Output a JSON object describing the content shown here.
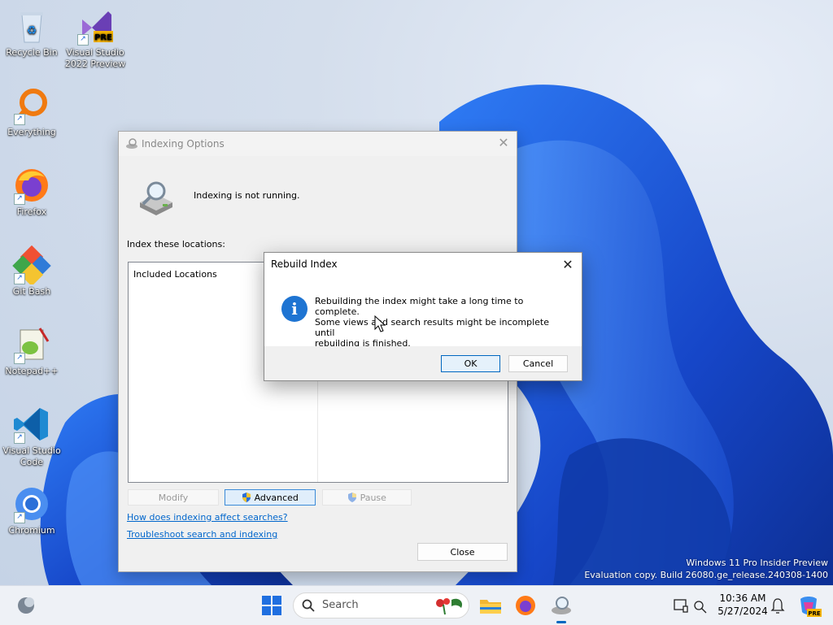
{
  "desktop": {
    "icons": [
      {
        "label": "Recycle Bin"
      },
      {
        "label": "Visual Studio 2022 Preview",
        "badge": "PRE"
      },
      {
        "label": "Everything"
      },
      {
        "label": "Firefox"
      },
      {
        "label": "Git Bash"
      },
      {
        "label": "Notepad++"
      },
      {
        "label": "Visual Studio Code"
      },
      {
        "label": "Chromium"
      }
    ],
    "watermark": {
      "line1": "Windows 11 Pro Insider Preview",
      "line2": "Evaluation copy. Build 26080.ge_release.240308-1400"
    }
  },
  "indexing_window": {
    "title": "Indexing Options",
    "status": "Indexing is not running.",
    "locations_label": "Index these locations:",
    "column_header": "Included Locations",
    "buttons": {
      "modify": "Modify",
      "advanced": "Advanced",
      "pause": "Pause",
      "close": "Close"
    },
    "links": {
      "how": "How does indexing affect searches?",
      "troubleshoot": "Troubleshoot search and indexing"
    }
  },
  "rebuild_dialog": {
    "title": "Rebuild Index",
    "message_line1": "Rebuilding the index might take a long time to complete.",
    "message_line2": "Some views and search results might be incomplete until",
    "message_line3": "rebuilding is finished.",
    "ok": "OK",
    "cancel": "Cancel"
  },
  "taskbar": {
    "search_placeholder": "Search",
    "time": "10:36 AM",
    "date": "5/27/2024",
    "badge": "PRE"
  },
  "colors": {
    "accent": "#0067c0",
    "info_blue": "#1e74d2",
    "bloom_blue": "#1a4fd8"
  }
}
